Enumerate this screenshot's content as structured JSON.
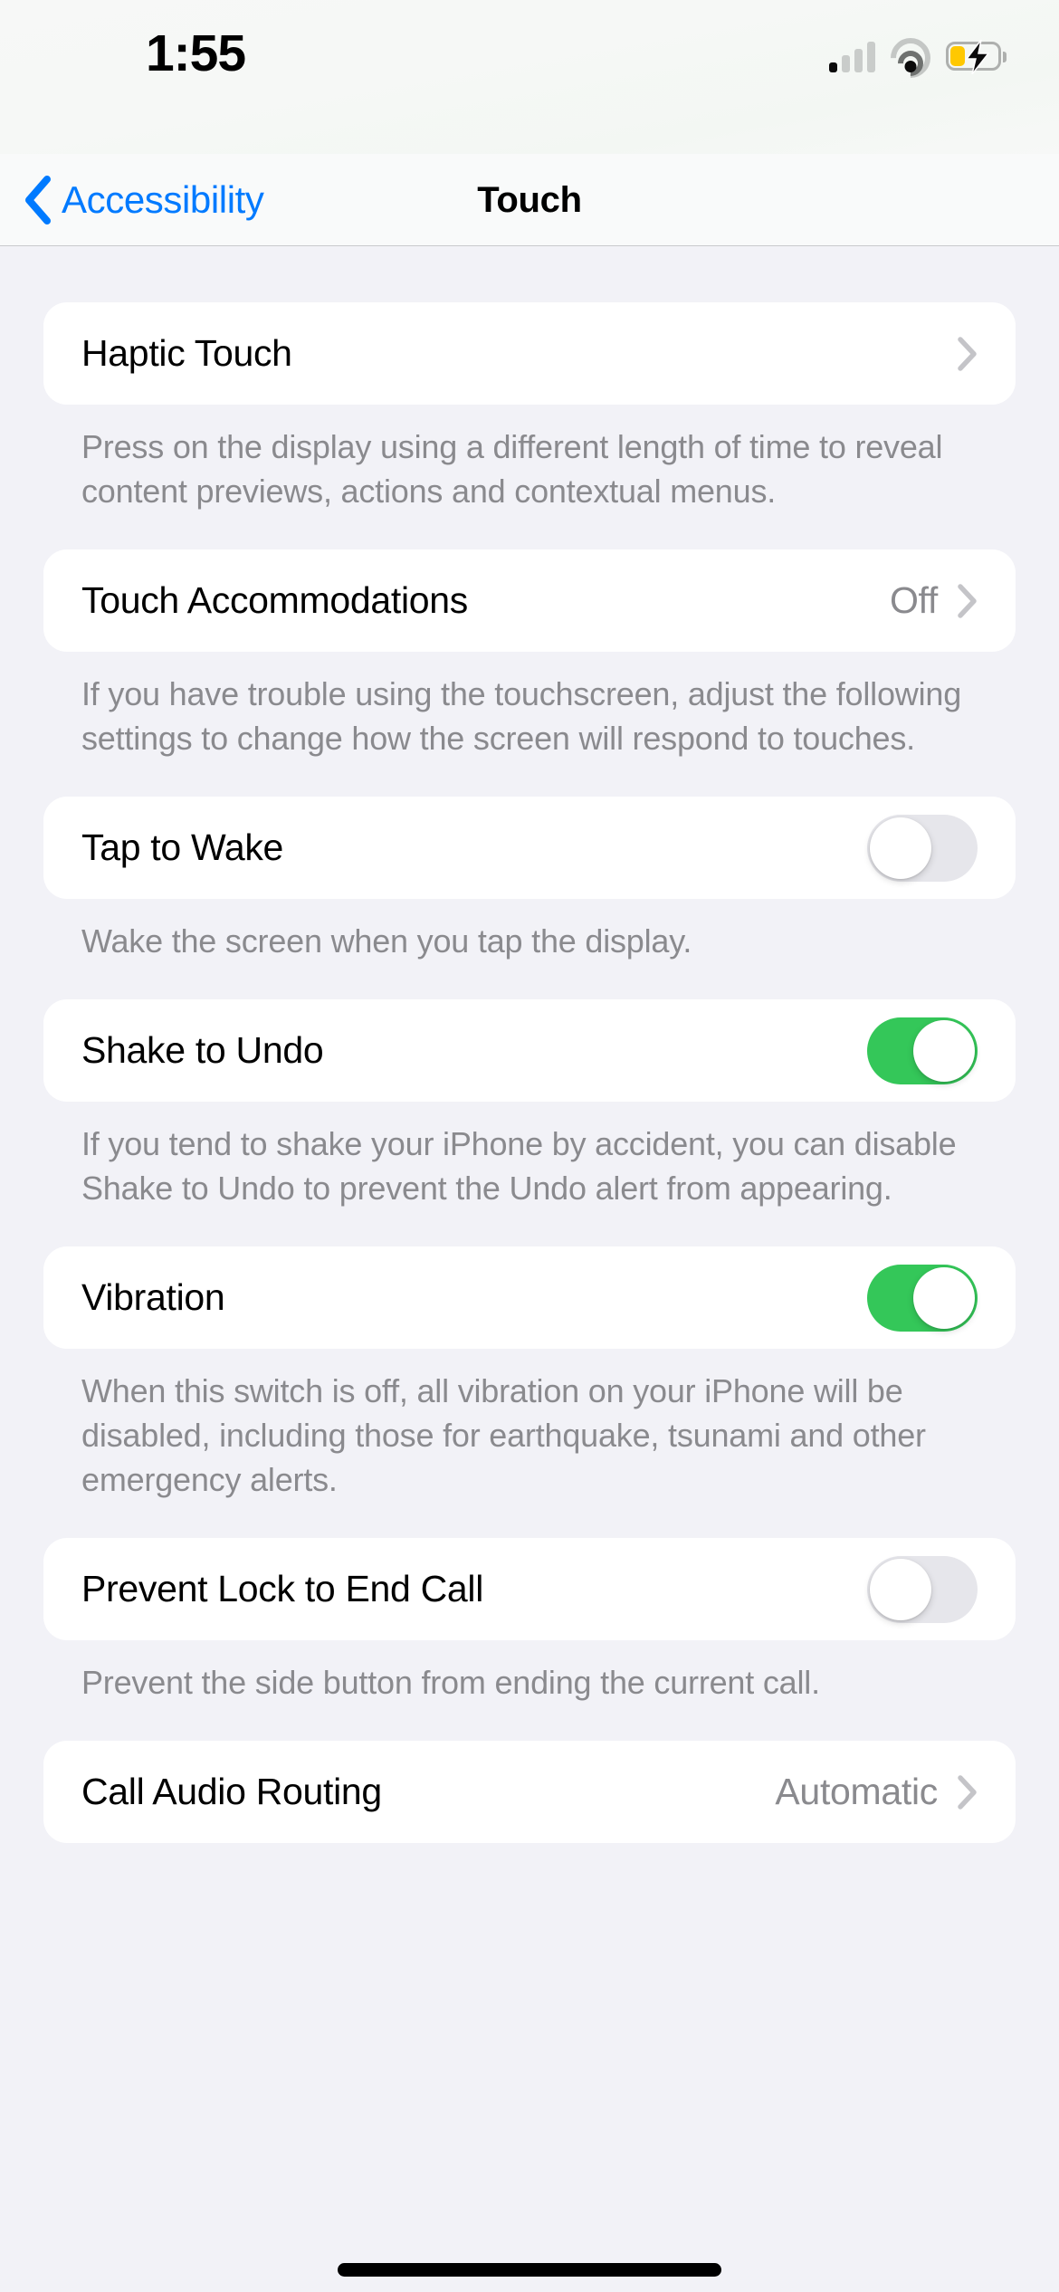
{
  "status_bar": {
    "time": "1:55",
    "cellular_icon": "cellular-bars-icon",
    "cellular_bars_filled": 1,
    "cellular_bars_total": 4,
    "wifi_icon": "wifi-icon",
    "battery_icon": "battery-charging-icon",
    "battery_charging": true,
    "battery_color": "#FFC800"
  },
  "nav": {
    "back_label": "Accessibility",
    "back_icon": "chevron-left-icon",
    "title": "Touch",
    "accent_color": "#007AFF"
  },
  "colors": {
    "background": "#F2F2F7",
    "card": "#FFFFFF",
    "toggle_on": "#34C759",
    "toggle_off": "#E6E6EB",
    "secondary_text": "#8A8A8E"
  },
  "groups": [
    {
      "rows": [
        {
          "label": "Haptic Touch",
          "type": "disclosure",
          "value": "",
          "accessory": "chevron-right-icon"
        }
      ],
      "footer": "Press on the display using a different length of time to reveal content previews, actions and contextual menus."
    },
    {
      "rows": [
        {
          "label": "Touch Accommodations",
          "type": "disclosure",
          "value": "Off",
          "accessory": "chevron-right-icon"
        }
      ],
      "footer": "If you have trouble using the touchscreen, adjust the following settings to change how the screen will respond to touches."
    },
    {
      "rows": [
        {
          "label": "Tap to Wake",
          "type": "toggle",
          "value": "off",
          "accessory": "toggle-switch"
        }
      ],
      "footer": "Wake the screen when you tap the display."
    },
    {
      "rows": [
        {
          "label": "Shake to Undo",
          "type": "toggle",
          "value": "on",
          "accessory": "toggle-switch"
        }
      ],
      "footer": "If you tend to shake your iPhone by accident, you can disable Shake to Undo to prevent the Undo alert from appearing."
    },
    {
      "rows": [
        {
          "label": "Vibration",
          "type": "toggle",
          "value": "on",
          "accessory": "toggle-switch"
        }
      ],
      "footer": "When this switch is off, all vibration on your iPhone will be disabled, including those for earthquake, tsunami and other emergency alerts."
    },
    {
      "rows": [
        {
          "label": "Prevent Lock to End Call",
          "type": "toggle",
          "value": "off",
          "accessory": "toggle-switch"
        }
      ],
      "footer": "Prevent the side button from ending the current call."
    },
    {
      "rows": [
        {
          "label": "Call Audio Routing",
          "type": "disclosure",
          "value": "Automatic",
          "accessory": "chevron-right-icon"
        }
      ],
      "footer": ""
    }
  ]
}
